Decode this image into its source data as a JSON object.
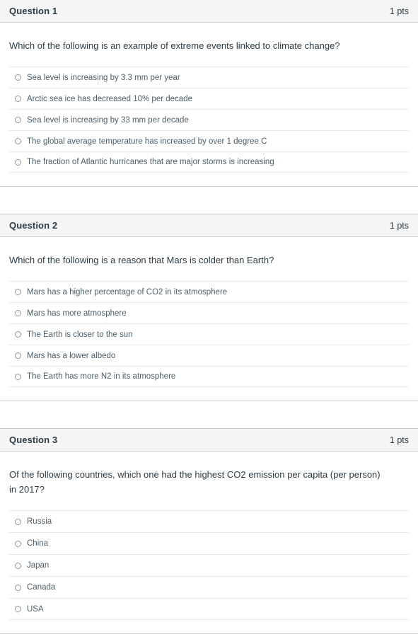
{
  "quiz": {
    "points_label": "1 pts",
    "questions": [
      {
        "name": "Question 1",
        "points": "1 pts",
        "text": "Which of the following is an example of extreme events linked to climate change?",
        "answers": [
          "Sea level is increasing by 3.3 mm per year",
          "Arctic sea ice has decreased 10% per decade",
          "Sea level is increasing by 33 mm per decade",
          "The global average temperature has increased by over 1 degree C",
          "The fraction of Atlantic hurricanes that are major storms is increasing"
        ]
      },
      {
        "name": "Question 2",
        "points": "1 pts",
        "text": "Which of the following is a reason that Mars is colder than Earth?",
        "answers": [
          "Mars has a higher percentage of CO2 in its atmosphere",
          "Mars has more atmosphere",
          "The Earth is closer to the sun",
          "Mars has a lower albedo",
          "The Earth has more N2 in its atmosphere"
        ]
      },
      {
        "name": "Question 3",
        "points": "1 pts",
        "text": "Of the following countries, which one had the highest CO2 emission per capita (per person) in 2017?",
        "answers": [
          "Russia",
          "China",
          "Japan",
          "Canada",
          "USA"
        ]
      }
    ]
  },
  "colors": {
    "header_background": "#f5f5f5",
    "block_border": "#c7cdd1",
    "row_border": "#e8eaec",
    "heading_text": "#2d3b45",
    "answer_text": "#4c5d68",
    "radio_border": "#8b969e"
  },
  "icons": {
    "radio_unselected": "radio-unselected-icon"
  }
}
